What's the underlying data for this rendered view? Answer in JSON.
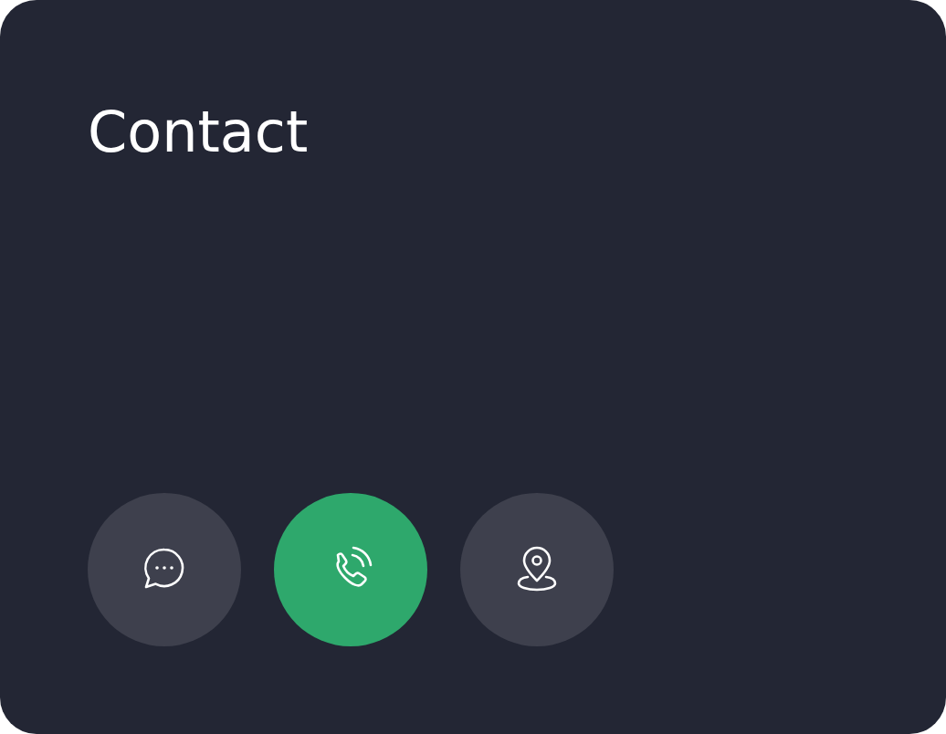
{
  "title": "Contact",
  "actions": [
    {
      "kind": "chat",
      "selected": false
    },
    {
      "kind": "phone",
      "selected": true
    },
    {
      "kind": "location",
      "selected": false
    }
  ]
}
